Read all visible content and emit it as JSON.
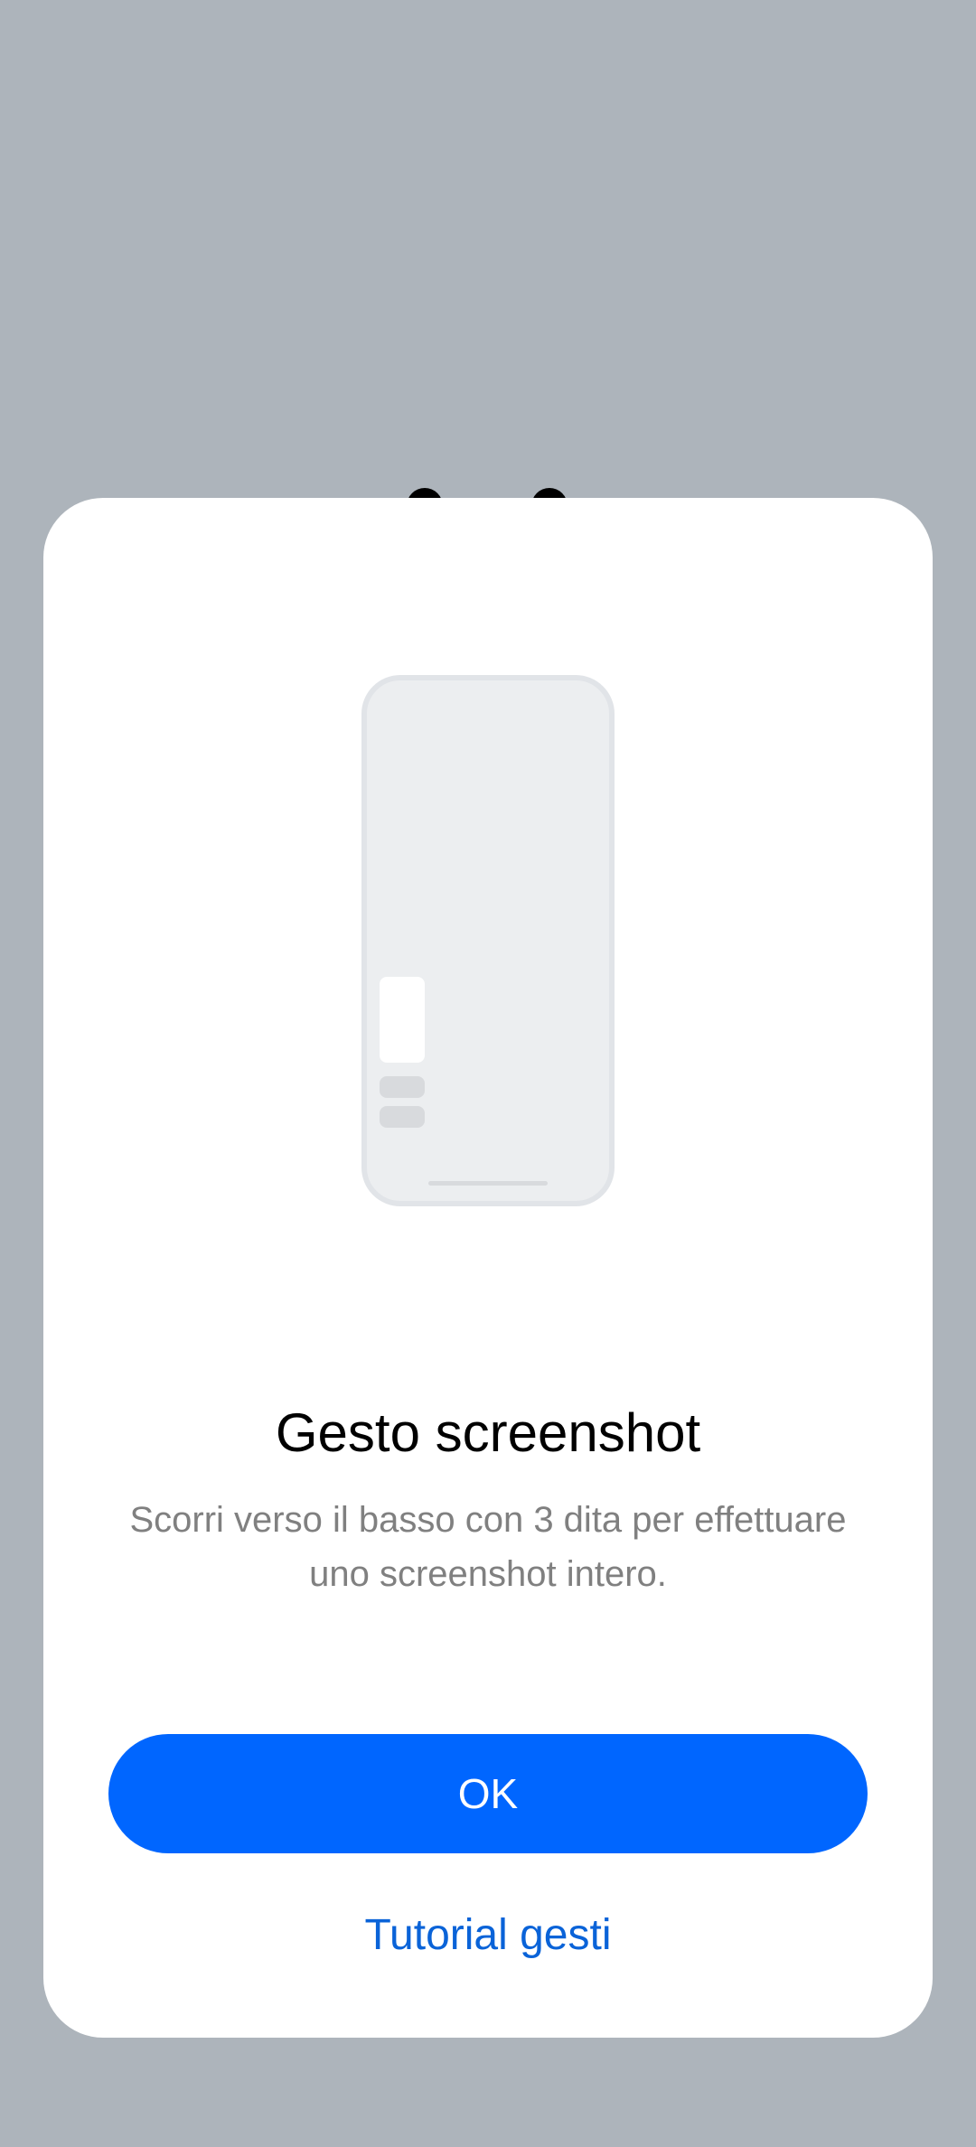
{
  "dialog": {
    "illustration_icon": "phone-screenshot-gesture-illustration",
    "title": "Gesto screenshot",
    "description": "Scorri verso il basso con 3 dita per effettuare uno screenshot intero.",
    "ok_label": "OK",
    "tutorial_label": "Tutorial gesti"
  },
  "colors": {
    "backdrop": "#adb4bb",
    "dialog_background": "#ffffff",
    "primary_button": "#0066ff",
    "link": "#0a63d8",
    "title_text": "#000000",
    "description_text": "#808080",
    "illustration_fill": "#eceef0",
    "illustration_stroke": "#e1e4e8"
  }
}
